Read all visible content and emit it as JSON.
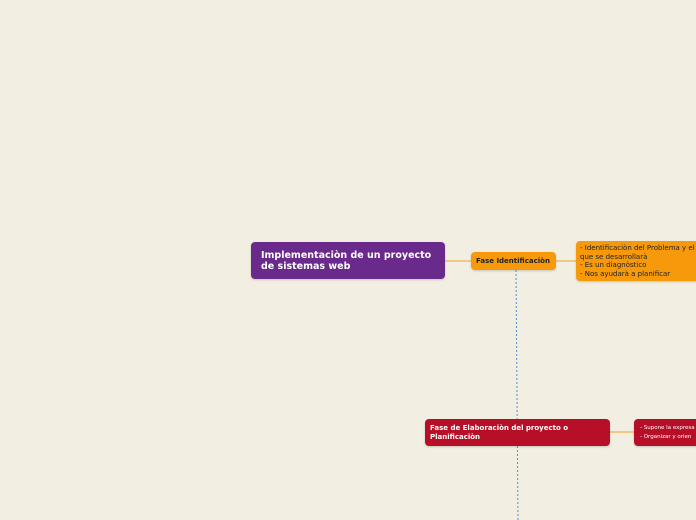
{
  "colors": {
    "background": "#f2efe2",
    "root_fill": "#6a2a8c",
    "phase1_fill": "#f69a0c",
    "phase2_fill": "#b60f27",
    "connector_solid": "#f2a12c",
    "connector_dashed": "#4f8fd6"
  },
  "map": {
    "root": {
      "label": "Implementaciòn de un proyecto de sistemas web"
    },
    "phase_identification": {
      "label": "Fase Identificaciòn",
      "details": [
        "- Identificaciòn del Problema y el",
        "que se desarrollarà",
        "- Es un diagnòstico",
        "- Nos ayudarà a planificar"
      ]
    },
    "phase_planning": {
      "label": "Fase de Elaboraciòn del proyecto o Planificaciòn",
      "details": [
        "- Supone la expresa",
        "- Organizar y orien"
      ]
    }
  }
}
